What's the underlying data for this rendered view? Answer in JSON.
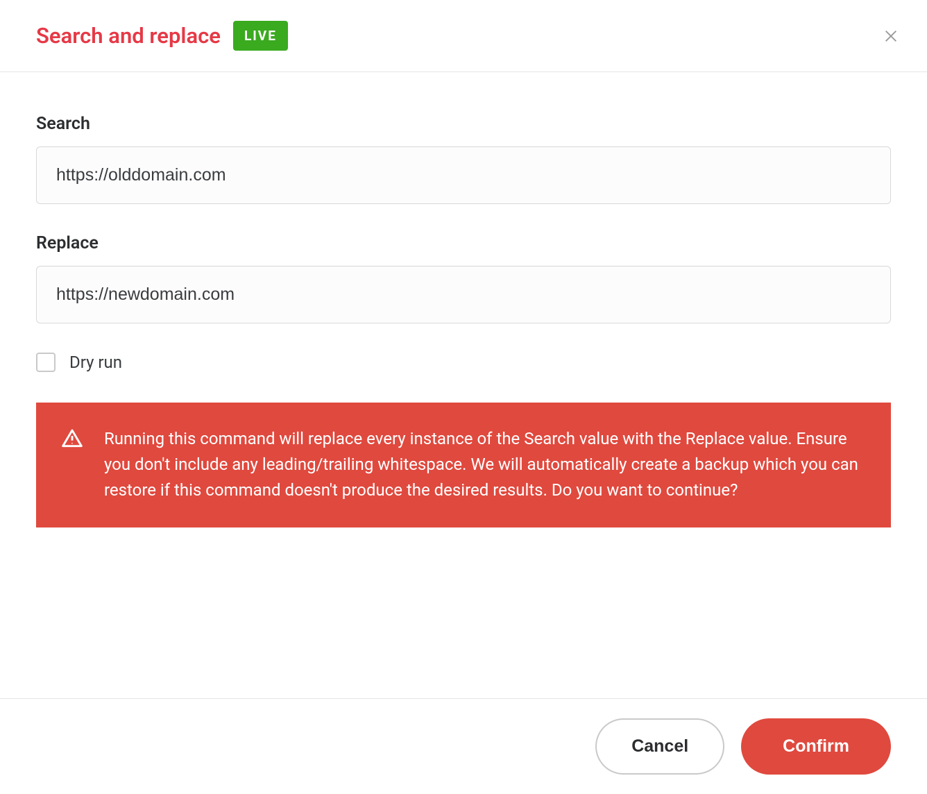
{
  "header": {
    "title": "Search and replace",
    "badge": "LIVE"
  },
  "form": {
    "search": {
      "label": "Search",
      "value": "https://olddomain.com"
    },
    "replace": {
      "label": "Replace",
      "value": "https://newdomain.com"
    },
    "dryRun": {
      "label": "Dry run",
      "checked": false
    }
  },
  "warning": {
    "message": "Running this command will replace every instance of the Search value with the Replace value. Ensure you don't include any leading/trailing whitespace. We will automatically create a backup which you can restore if this command doesn't produce the desired results. Do you want to continue?"
  },
  "footer": {
    "cancel": "Cancel",
    "confirm": "Confirm"
  }
}
